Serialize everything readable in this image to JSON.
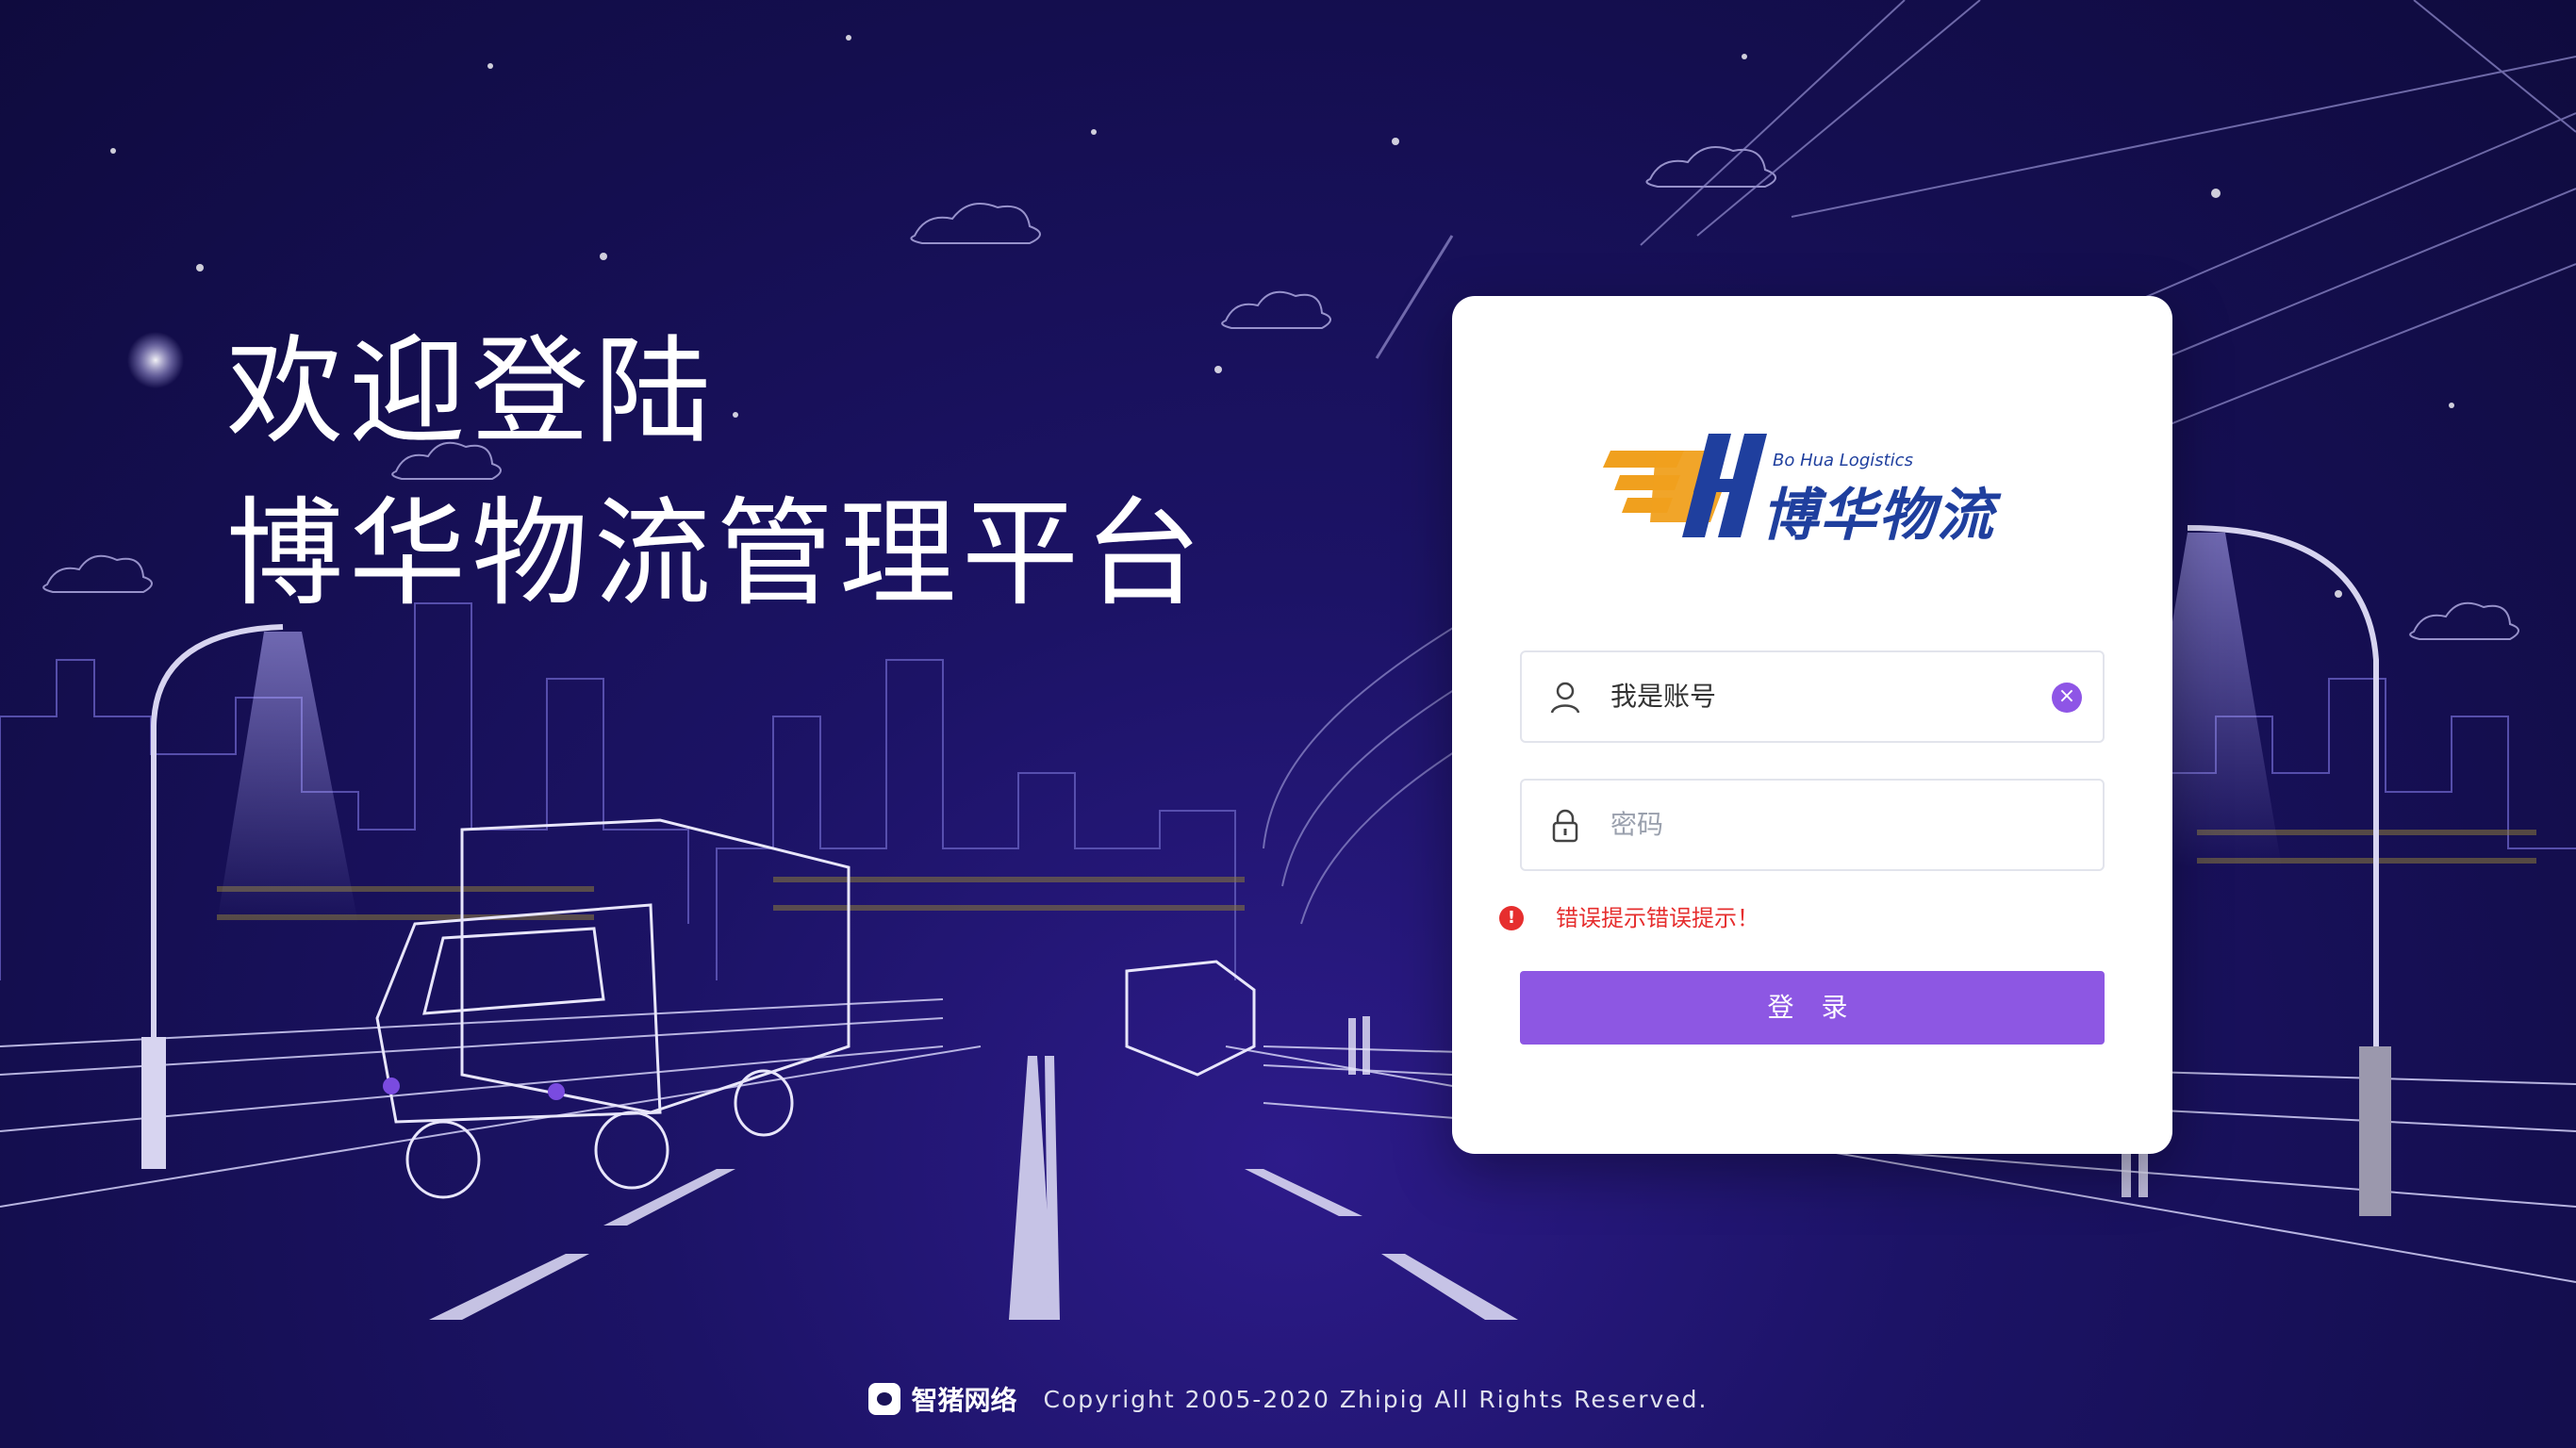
{
  "welcome": {
    "line1": "欢迎登陆",
    "line2": "博华物流管理平台"
  },
  "logo": {
    "mark": "BH",
    "english": "Bo Hua Logistics",
    "chinese": "博华物流",
    "colors": {
      "mark_orange": "#f0a01e",
      "brand_blue": "#1f3f9e"
    }
  },
  "form": {
    "username": {
      "value": "我是账号",
      "icon": "user-icon",
      "clear_icon": "close-icon"
    },
    "password": {
      "placeholder": "密码",
      "icon": "lock-icon"
    },
    "error": {
      "message": "错误提示错误提示！",
      "icon": "exclamation-icon"
    },
    "submit_label": "登 录"
  },
  "footer": {
    "brand": "智猪网络",
    "copyright": "Copyright 2005-2020 Zhipig All Rights Reserved."
  },
  "colors": {
    "accent": "#8d57e3",
    "error": "#e62e2e",
    "background": "#1c1366"
  }
}
